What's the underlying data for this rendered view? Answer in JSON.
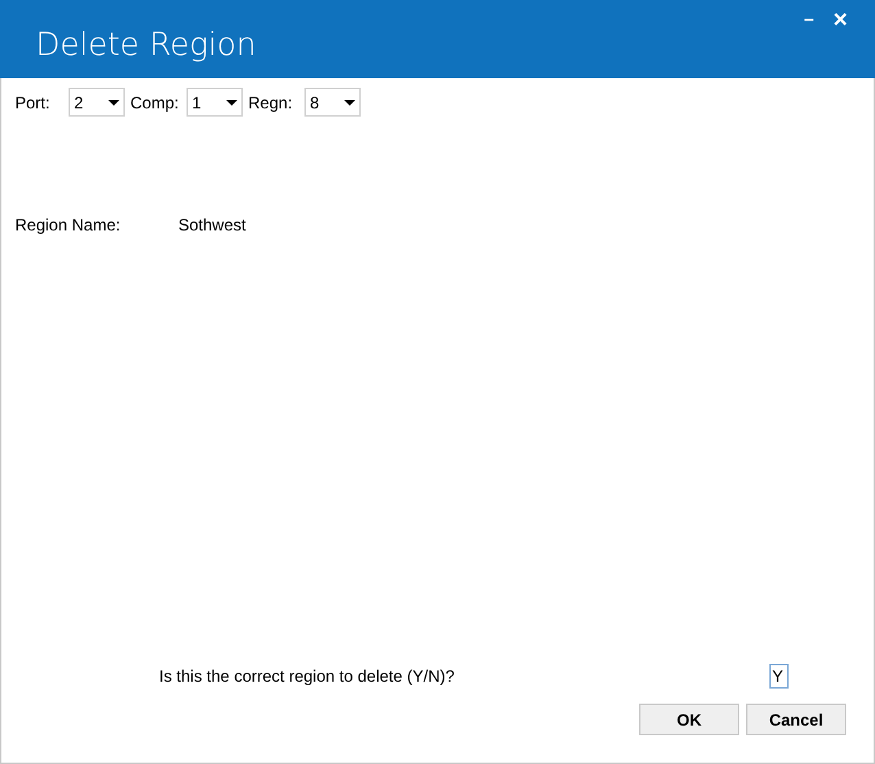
{
  "window": {
    "title": "Delete Region",
    "controls": [
      {
        "kind": "minimize",
        "label": "–"
      },
      {
        "kind": "close",
        "label": "×"
      }
    ]
  },
  "selectors": [
    {
      "label": "Port:",
      "value": "2"
    },
    {
      "label": "Comp:",
      "value": "1"
    },
    {
      "label": "Regn:",
      "value": "8"
    }
  ],
  "region_name": {
    "label": "Region Name:",
    "value": "Sothwest"
  },
  "confirm": {
    "question": "Is this the correct region to delete (Y/N)?",
    "value": "Y"
  },
  "buttons": [
    {
      "label": "OK"
    },
    {
      "label": "Cancel"
    }
  ]
}
